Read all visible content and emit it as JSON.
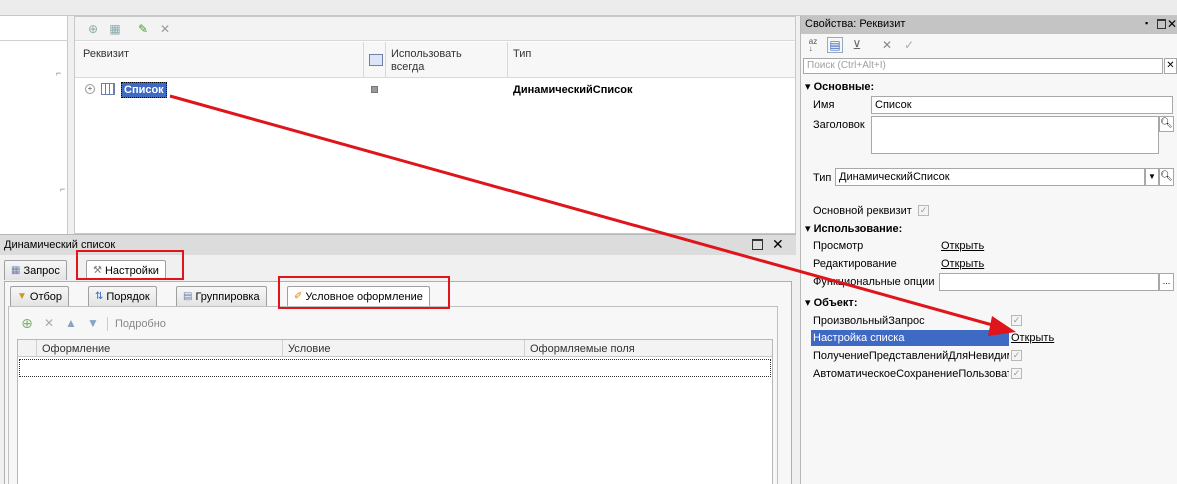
{
  "main_grid": {
    "toolbar_icons": [
      "add-attribute-icon",
      "add-column-icon",
      "edit-icon",
      "delete-icon"
    ],
    "headers": {
      "attribute": "Реквизит",
      "use_always_line1": "Использовать",
      "use_always_line2": "всегда",
      "type": "Тип"
    },
    "rows": [
      {
        "name": "Список",
        "type": "ДинамическийСписок"
      }
    ]
  },
  "dynamic_list_panel": {
    "title": "Динамический список",
    "tabs": [
      "Запрос",
      "Настройки"
    ],
    "subtabs": [
      "Отбор",
      "Порядок",
      "Группировка",
      "Условное оформление"
    ],
    "toolbar_detail": "Подробно",
    "columns": [
      "Оформление",
      "Условие",
      "Оформляемые поля"
    ]
  },
  "properties": {
    "title": "Свойства: Реквизит",
    "search_placeholder": "Поиск (Ctrl+Alt+I)",
    "sections": {
      "main": "Основные:",
      "usage": "Использование:",
      "object": "Объект:"
    },
    "fields": {
      "name_label": "Имя",
      "name_value": "Список",
      "header_label": "Заголовок",
      "type_label": "Тип",
      "type_value": "ДинамическийСписок",
      "main_attr_label": "Основной реквизит",
      "view_label": "Просмотр",
      "view_link": "Открыть",
      "edit_label": "Редактирование",
      "edit_link": "Открыть",
      "func_options_label": "Функциональные опции",
      "arbitrary_query_label": "ПроизвольныйЗапрос",
      "list_settings_label": "Настройка списка",
      "list_settings_link": "Открыть",
      "get_invisible_label": "ПолучениеПредставленийДляНевидимых",
      "auto_save_label": "АвтоматическоеСохранениеПользователь"
    },
    "accent_color": "#3f6ac4"
  },
  "annotation_color": "#e0141b"
}
